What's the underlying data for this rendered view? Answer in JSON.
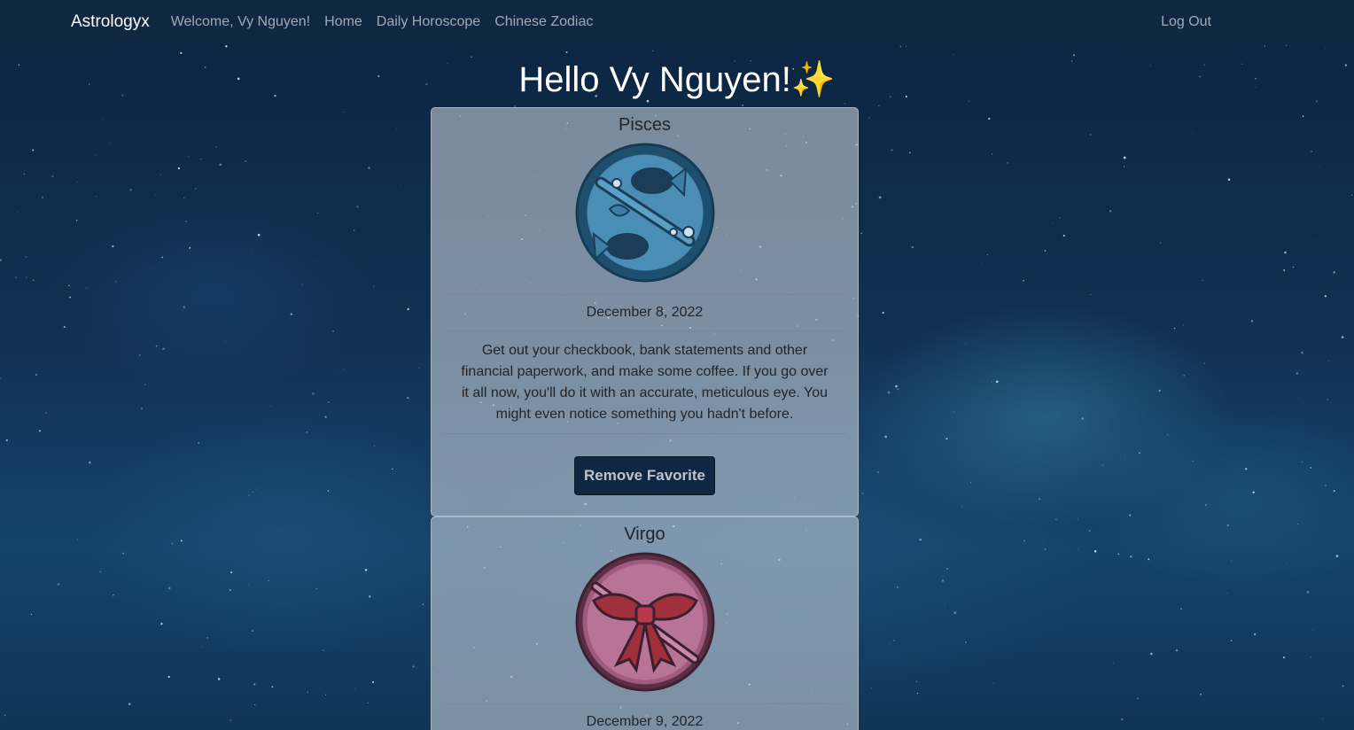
{
  "navbar": {
    "brand": "Astrologyx",
    "welcome": "Welcome, Vy Nguyen!",
    "links": [
      "Home",
      "Daily Horoscope",
      "Chinese Zodiac"
    ],
    "logout": "Log Out"
  },
  "greeting": {
    "text": "Hello Vy Nguyen!",
    "emoji": "✨"
  },
  "favorites": [
    {
      "sign": "Pisces",
      "icon": "pisces-icon",
      "date": "December 8, 2022",
      "horoscope": "Get out your checkbook, bank statements and other financial paperwork, and make some coffee. If you go over it all now, you'll do it with an accurate, meticulous eye. You might even notice something you hadn't before.",
      "button": "Remove Favorite"
    },
    {
      "sign": "Virgo",
      "icon": "virgo-icon",
      "date": "December 9, 2022"
    }
  ],
  "colors": {
    "navbar": "#0f2740",
    "button": "#0f2740",
    "pisces": "#2f6f96",
    "virgo": "#b06a8e"
  }
}
